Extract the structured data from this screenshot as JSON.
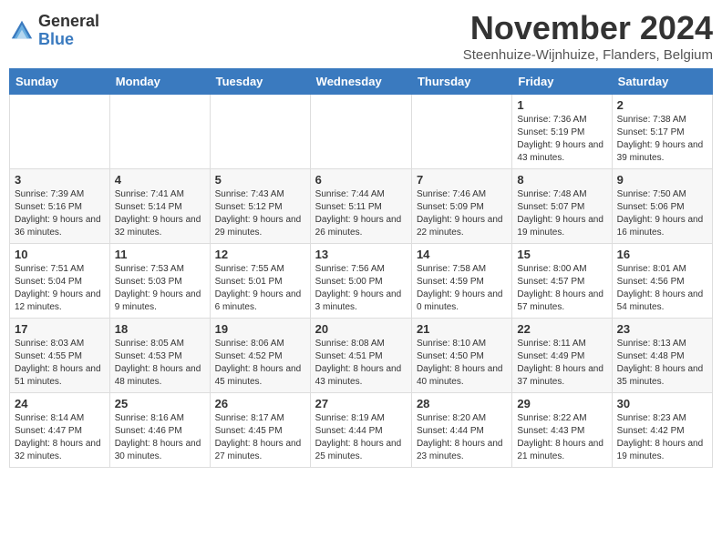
{
  "logo": {
    "general": "General",
    "blue": "Blue"
  },
  "title": "November 2024",
  "subtitle": "Steenhuize-Wijnhuize, Flanders, Belgium",
  "days_of_week": [
    "Sunday",
    "Monday",
    "Tuesday",
    "Wednesday",
    "Thursday",
    "Friday",
    "Saturday"
  ],
  "weeks": [
    [
      {
        "day": "",
        "info": ""
      },
      {
        "day": "",
        "info": ""
      },
      {
        "day": "",
        "info": ""
      },
      {
        "day": "",
        "info": ""
      },
      {
        "day": "",
        "info": ""
      },
      {
        "day": "1",
        "info": "Sunrise: 7:36 AM\nSunset: 5:19 PM\nDaylight: 9 hours and 43 minutes."
      },
      {
        "day": "2",
        "info": "Sunrise: 7:38 AM\nSunset: 5:17 PM\nDaylight: 9 hours and 39 minutes."
      }
    ],
    [
      {
        "day": "3",
        "info": "Sunrise: 7:39 AM\nSunset: 5:16 PM\nDaylight: 9 hours and 36 minutes."
      },
      {
        "day": "4",
        "info": "Sunrise: 7:41 AM\nSunset: 5:14 PM\nDaylight: 9 hours and 32 minutes."
      },
      {
        "day": "5",
        "info": "Sunrise: 7:43 AM\nSunset: 5:12 PM\nDaylight: 9 hours and 29 minutes."
      },
      {
        "day": "6",
        "info": "Sunrise: 7:44 AM\nSunset: 5:11 PM\nDaylight: 9 hours and 26 minutes."
      },
      {
        "day": "7",
        "info": "Sunrise: 7:46 AM\nSunset: 5:09 PM\nDaylight: 9 hours and 22 minutes."
      },
      {
        "day": "8",
        "info": "Sunrise: 7:48 AM\nSunset: 5:07 PM\nDaylight: 9 hours and 19 minutes."
      },
      {
        "day": "9",
        "info": "Sunrise: 7:50 AM\nSunset: 5:06 PM\nDaylight: 9 hours and 16 minutes."
      }
    ],
    [
      {
        "day": "10",
        "info": "Sunrise: 7:51 AM\nSunset: 5:04 PM\nDaylight: 9 hours and 12 minutes."
      },
      {
        "day": "11",
        "info": "Sunrise: 7:53 AM\nSunset: 5:03 PM\nDaylight: 9 hours and 9 minutes."
      },
      {
        "day": "12",
        "info": "Sunrise: 7:55 AM\nSunset: 5:01 PM\nDaylight: 9 hours and 6 minutes."
      },
      {
        "day": "13",
        "info": "Sunrise: 7:56 AM\nSunset: 5:00 PM\nDaylight: 9 hours and 3 minutes."
      },
      {
        "day": "14",
        "info": "Sunrise: 7:58 AM\nSunset: 4:59 PM\nDaylight: 9 hours and 0 minutes."
      },
      {
        "day": "15",
        "info": "Sunrise: 8:00 AM\nSunset: 4:57 PM\nDaylight: 8 hours and 57 minutes."
      },
      {
        "day": "16",
        "info": "Sunrise: 8:01 AM\nSunset: 4:56 PM\nDaylight: 8 hours and 54 minutes."
      }
    ],
    [
      {
        "day": "17",
        "info": "Sunrise: 8:03 AM\nSunset: 4:55 PM\nDaylight: 8 hours and 51 minutes."
      },
      {
        "day": "18",
        "info": "Sunrise: 8:05 AM\nSunset: 4:53 PM\nDaylight: 8 hours and 48 minutes."
      },
      {
        "day": "19",
        "info": "Sunrise: 8:06 AM\nSunset: 4:52 PM\nDaylight: 8 hours and 45 minutes."
      },
      {
        "day": "20",
        "info": "Sunrise: 8:08 AM\nSunset: 4:51 PM\nDaylight: 8 hours and 43 minutes."
      },
      {
        "day": "21",
        "info": "Sunrise: 8:10 AM\nSunset: 4:50 PM\nDaylight: 8 hours and 40 minutes."
      },
      {
        "day": "22",
        "info": "Sunrise: 8:11 AM\nSunset: 4:49 PM\nDaylight: 8 hours and 37 minutes."
      },
      {
        "day": "23",
        "info": "Sunrise: 8:13 AM\nSunset: 4:48 PM\nDaylight: 8 hours and 35 minutes."
      }
    ],
    [
      {
        "day": "24",
        "info": "Sunrise: 8:14 AM\nSunset: 4:47 PM\nDaylight: 8 hours and 32 minutes."
      },
      {
        "day": "25",
        "info": "Sunrise: 8:16 AM\nSunset: 4:46 PM\nDaylight: 8 hours and 30 minutes."
      },
      {
        "day": "26",
        "info": "Sunrise: 8:17 AM\nSunset: 4:45 PM\nDaylight: 8 hours and 27 minutes."
      },
      {
        "day": "27",
        "info": "Sunrise: 8:19 AM\nSunset: 4:44 PM\nDaylight: 8 hours and 25 minutes."
      },
      {
        "day": "28",
        "info": "Sunrise: 8:20 AM\nSunset: 4:44 PM\nDaylight: 8 hours and 23 minutes."
      },
      {
        "day": "29",
        "info": "Sunrise: 8:22 AM\nSunset: 4:43 PM\nDaylight: 8 hours and 21 minutes."
      },
      {
        "day": "30",
        "info": "Sunrise: 8:23 AM\nSunset: 4:42 PM\nDaylight: 8 hours and 19 minutes."
      }
    ]
  ]
}
